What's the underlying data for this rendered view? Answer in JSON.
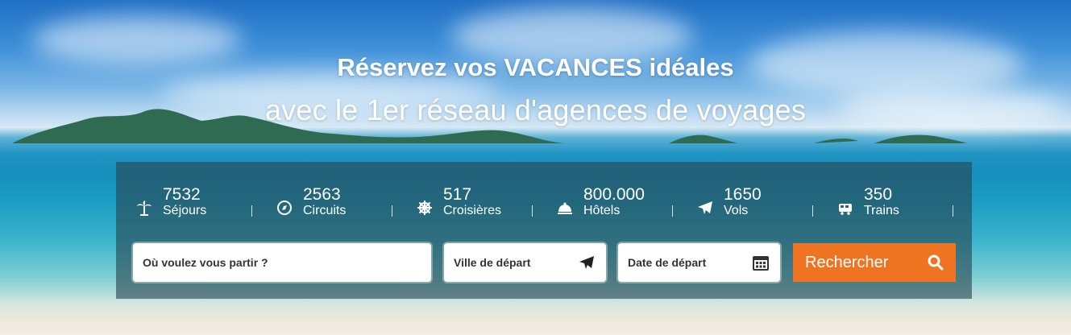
{
  "hero": {
    "title": "Réservez vos VACANCES idéales",
    "subtitle": "avec le 1er réseau d'agences de voyages"
  },
  "stats": [
    {
      "icon": "palm-tree-icon",
      "count": "7532",
      "label": "Séjours"
    },
    {
      "icon": "compass-icon",
      "count": "2563",
      "label": "Circuits"
    },
    {
      "icon": "ship-wheel-icon",
      "count": "517",
      "label": "Croisières"
    },
    {
      "icon": "hotel-bell-icon",
      "count": "800.000",
      "label": "Hôtels"
    },
    {
      "icon": "plane-icon",
      "count": "1650",
      "label": "Vols"
    },
    {
      "icon": "train-icon",
      "count": "350",
      "label": "Trains"
    }
  ],
  "search": {
    "destination_placeholder": "Où voulez vous partir ?",
    "departure_city_placeholder": "Ville de départ",
    "departure_date_placeholder": "Date de départ",
    "submit_label": "Rechercher",
    "button_color": "#ee7421"
  }
}
